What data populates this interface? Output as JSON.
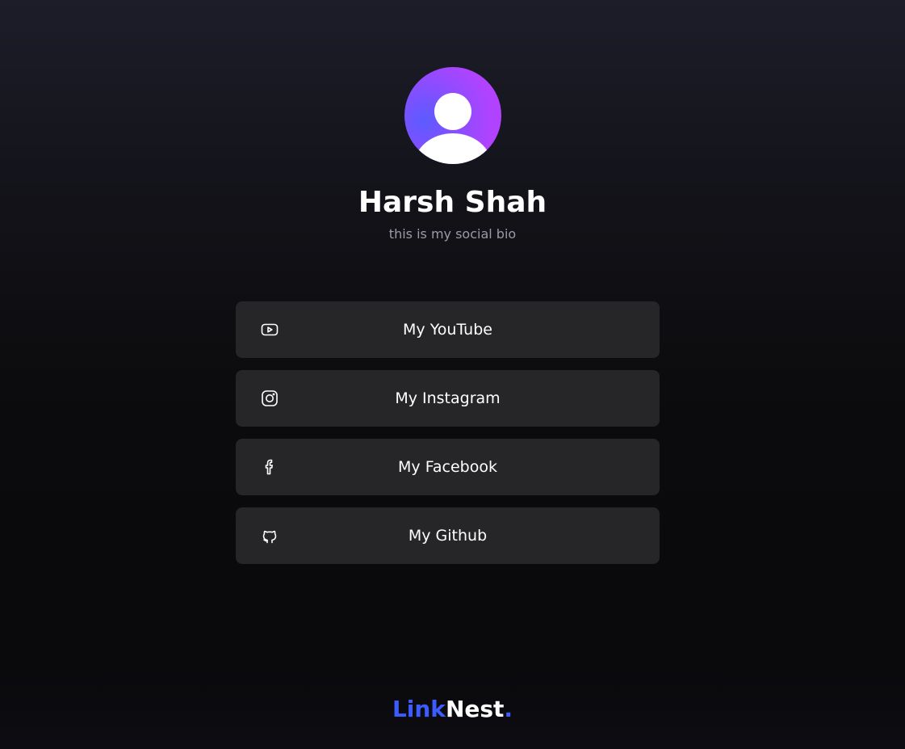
{
  "profile": {
    "name": "Harsh Shah",
    "bio": "this is my social bio",
    "avatar_icon": "user-avatar-icon"
  },
  "links": [
    {
      "label": "My YouTube",
      "icon": "youtube-icon"
    },
    {
      "label": "My Instagram",
      "icon": "instagram-icon"
    },
    {
      "label": "My Facebook",
      "icon": "facebook-icon"
    },
    {
      "label": "My Github",
      "icon": "github-icon"
    }
  ],
  "brand": {
    "part1": "Link",
    "part2": "Nest",
    "part3": "."
  },
  "colors": {
    "accent": "#3d5cff",
    "avatar_gradient_start": "#5b5bff",
    "avatar_gradient_end": "#b640ff",
    "button_bg": "#262628",
    "bio_text": "#9a9aa8"
  }
}
